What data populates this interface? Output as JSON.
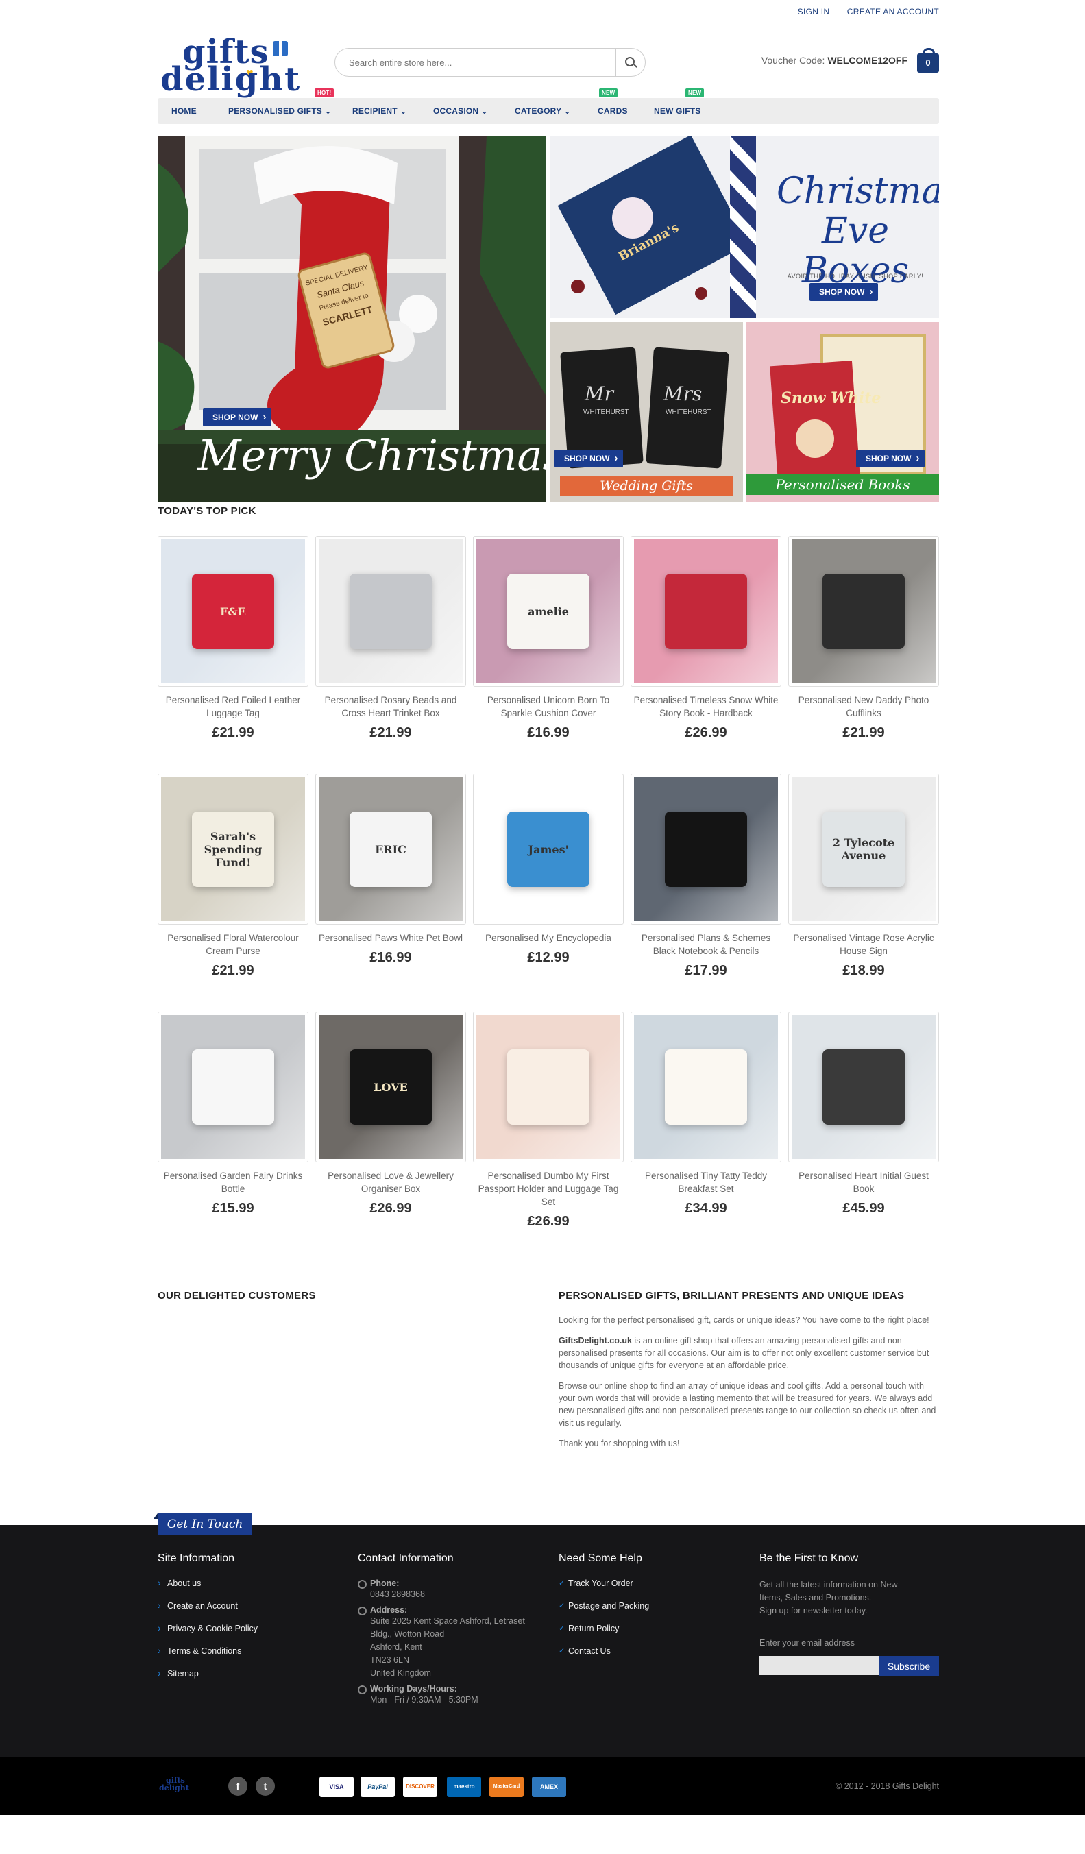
{
  "topbar": {
    "sign_in": "SIGN IN",
    "create_account": "CREATE AN ACCOUNT"
  },
  "header": {
    "logo_line1": "gifts",
    "logo_line2": "delight",
    "search_placeholder": "Search entire store here...",
    "voucher_label": "Voucher Code:",
    "voucher_code": "WELCOME12OFF",
    "cart_count": "0"
  },
  "nav": [
    {
      "label": "HOME"
    },
    {
      "label": "PERSONALISED GIFTS ⌄",
      "badge": "HOT!",
      "badge_color": "#e8335a"
    },
    {
      "label": "RECIPIENT ⌄"
    },
    {
      "label": "OCCASION ⌄"
    },
    {
      "label": "CATEGORY ⌄"
    },
    {
      "label": "CARDS",
      "badge": "NEW",
      "badge_color": "#2bb673"
    },
    {
      "label": "NEW GIFTS",
      "badge": "NEW",
      "badge_color": "#2bb673"
    }
  ],
  "banners": {
    "main": {
      "text": "Merry Christmas",
      "button": "SHOP NOW",
      "tag_lines": [
        "SPECIAL DELIVERY",
        "Santa Claus",
        "Please deliver to",
        "SCARLETT"
      ]
    },
    "eve": {
      "title_line1": "Christmas",
      "title_line2": "Eve Boxes",
      "subtitle": "AVOID THE HOLIDAY RUSH. SHOP EARLY!",
      "button": "SHOP NOW",
      "box_name": "Brianna's"
    },
    "wedding": {
      "label": "Wedding Gifts",
      "button": "SHOP NOW",
      "mr": "Mr",
      "mrs": "Mrs",
      "surname": "WHITEHURST"
    },
    "books": {
      "label": "Personalised Books",
      "button": "SHOP NOW",
      "book_title": "Snow White"
    }
  },
  "top_pick": {
    "title": "TODAY'S TOP PICK",
    "products": [
      {
        "name": "Personalised Red Foiled Leather Luggage Tag",
        "price": "£21.99",
        "bg": "#dfe6ee",
        "accent": "#d4253a",
        "img_text": "F&E"
      },
      {
        "name": "Personalised Rosary Beads and Cross Heart Trinket Box",
        "price": "£21.99",
        "bg": "#ececec",
        "accent": "#c5c7cb",
        "img_text": ""
      },
      {
        "name": "Personalised Unicorn Born To Sparkle Cushion Cover",
        "price": "£16.99",
        "bg": "#c99ab2",
        "accent": "#f7f5f2",
        "img_text": "amelie"
      },
      {
        "name": "Personalised Timeless Snow White Story Book - Hardback",
        "price": "£26.99",
        "bg": "#e69bb0",
        "accent": "#c4283a",
        "img_text": ""
      },
      {
        "name": "Personalised New Daddy Photo Cufflinks",
        "price": "£21.99",
        "bg": "#8e8c88",
        "accent": "#2d2d2d",
        "img_text": ""
      },
      {
        "name": "Personalised Floral Watercolour Cream Purse",
        "price": "£21.99",
        "bg": "#d7d3c6",
        "accent": "#f2eee2",
        "img_text": "Sarah's Spending Fund!"
      },
      {
        "name": "Personalised Paws White Pet Bowl",
        "price": "£16.99",
        "bg": "#9f9d99",
        "accent": "#f4f4f4",
        "img_text": "ERIC"
      },
      {
        "name": "Personalised My Encyclopedia",
        "price": "£12.99",
        "bg": "#ffffff",
        "accent": "#3a8fd0",
        "img_text": "James'"
      },
      {
        "name": "Personalised Plans & Schemes Black Notebook & Pencils",
        "price": "£17.99",
        "bg": "#5f6772",
        "accent": "#141414",
        "img_text": ""
      },
      {
        "name": "Personalised Vintage Rose Acrylic House Sign",
        "price": "£18.99",
        "bg": "#ececec",
        "accent": "#e0e4e6",
        "img_text": "2 Tylecote Avenue"
      },
      {
        "name": "Personalised Garden Fairy Drinks Bottle",
        "price": "£15.99",
        "bg": "#c7c9cc",
        "accent": "#f7f7f7",
        "img_text": ""
      },
      {
        "name": "Personalised Love & Jewellery Organiser Box",
        "price": "£26.99",
        "bg": "#6e6a66",
        "accent": "#151515",
        "img_text": "LOVE"
      },
      {
        "name": "Personalised Dumbo My First Passport Holder and Luggage Tag Set",
        "price": "£26.99",
        "bg": "#f1d9cf",
        "accent": "#f9eee4",
        "img_text": ""
      },
      {
        "name": "Personalised Tiny Tatty Teddy Breakfast Set",
        "price": "£34.99",
        "bg": "#cfd8df",
        "accent": "#fbf8f2",
        "img_text": ""
      },
      {
        "name": "Personalised Heart Initial Guest Book",
        "price": "£45.99",
        "bg": "#dfe4e8",
        "accent": "#3a3a3a",
        "img_text": ""
      }
    ]
  },
  "customers": {
    "title": "OUR DELIGHTED CUSTOMERS"
  },
  "about": {
    "title": "PERSONALISED GIFTS, BRILLIANT PRESENTS AND UNIQUE IDEAS",
    "p1": "Looking for the perfect personalised gift, cards or unique ideas? You have come to the right place!",
    "p2_bold": "GiftsDelight.co.uk",
    "p2_rest": " is an online gift shop that offers an amazing personalised gifts and non-personalised presents for all occasions. Our aim is to offer not only excellent customer service but thousands of unique gifts for everyone at an affordable price.",
    "p3": "Browse our online shop to find an array of unique ideas and cool gifts. Add a personal touch with your own words that will provide a lasting memento that will be treasured for years. We always add new personalised gifts and non-personalised presents range to our collection so check us often and visit us regularly.",
    "p4": "Thank you for shopping with us!"
  },
  "footer": {
    "get_in_touch": "Get In Touch",
    "site_info": {
      "title": "Site Information",
      "links": [
        "About us",
        "Create an Account",
        "Privacy & Cookie Policy",
        "Terms & Conditions",
        "Sitemap"
      ]
    },
    "contact": {
      "title": "Contact Information",
      "phone_label": "Phone:",
      "phone": "0843 2898368",
      "address_label": "Address:",
      "address": [
        "Suite 2025 Kent Space Ashford, Letraset",
        "Bldg., Wotton Road",
        "Ashford, Kent",
        "TN23 6LN",
        "United Kingdom"
      ],
      "hours_label": "Working Days/Hours:",
      "hours": "Mon - Fri / 9:30AM - 5:30PM"
    },
    "help": {
      "title": "Need Some Help",
      "links": [
        "Track Your Order",
        "Postage and Packing",
        "Return Policy",
        "Contact Us"
      ]
    },
    "newsletter": {
      "title": "Be the First to Know",
      "text_lines": [
        "Get all the latest information on New",
        "Items, Sales and Promotions.",
        "Sign up for newsletter today."
      ],
      "email_label": "Enter your email address",
      "button": "Subscribe"
    }
  },
  "bottom": {
    "logo_line1": "gifts",
    "logo_line2": "delight",
    "social": [
      "f",
      "t"
    ],
    "payments": [
      "VISA",
      "PayPal",
      "DISCOVER",
      "maestro",
      "MasterCard",
      "AMEX"
    ],
    "copyright": "© 2012 - 2018 Gifts Delight"
  }
}
